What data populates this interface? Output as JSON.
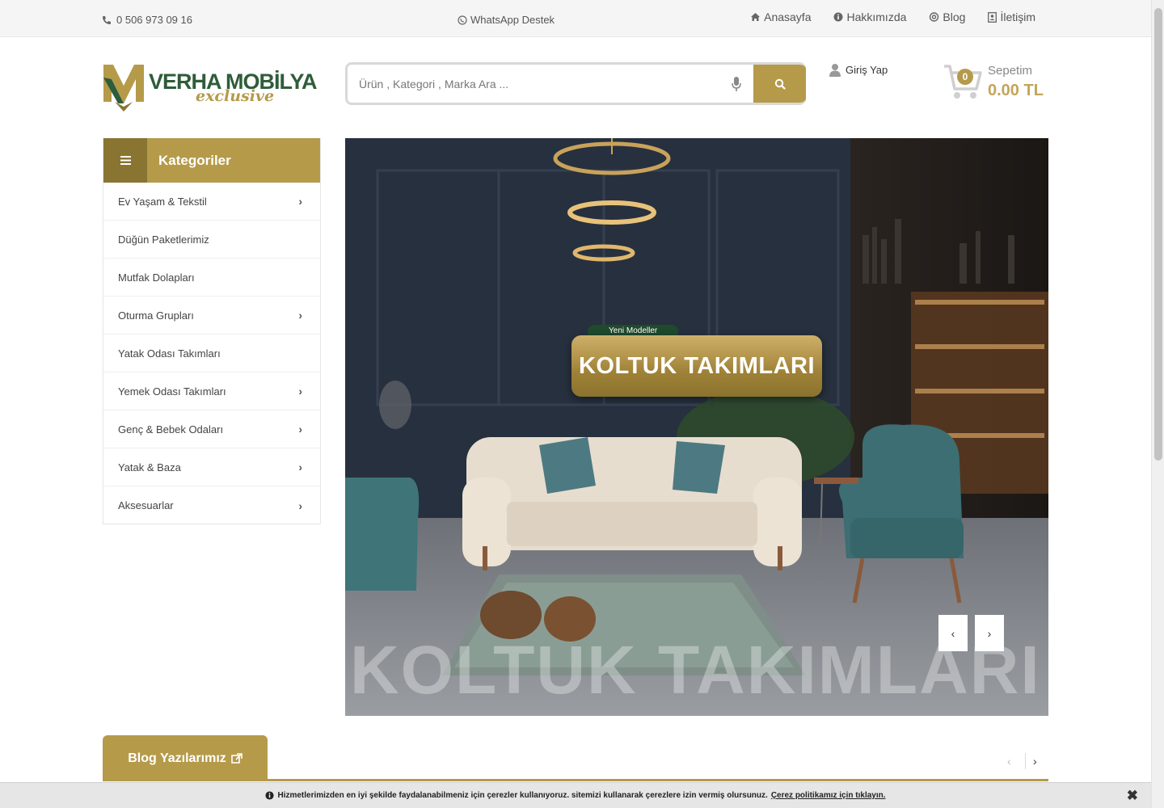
{
  "topbar": {
    "phone": "0 506 973 09 16",
    "whatsapp": "WhatsApp Destek",
    "nav": [
      {
        "label": "Anasayfa",
        "icon": "home-icon"
      },
      {
        "label": "Hakkımızda",
        "icon": "info-icon"
      },
      {
        "label": "Blog",
        "icon": "blog-icon"
      },
      {
        "label": "İletişim",
        "icon": "contact-icon"
      }
    ]
  },
  "header": {
    "logo_brand": "VERHA MOBİLYA",
    "logo_tagline": "exclusive",
    "search_placeholder": "Ürün , Kategori , Marka Ara ...",
    "login_label": "Giriş Yap",
    "cart_label": "Sepetim",
    "cart_count": "0",
    "cart_total": "0.00 TL"
  },
  "categories": {
    "title": "Kategoriler",
    "items": [
      {
        "label": "Ev Yaşam & Tekstil",
        "has_sub": true
      },
      {
        "label": "Düğün Paketlerimiz",
        "has_sub": false
      },
      {
        "label": "Mutfak Dolapları",
        "has_sub": false
      },
      {
        "label": "Oturma Grupları",
        "has_sub": true
      },
      {
        "label": "Yatak Odası Takımları",
        "has_sub": false
      },
      {
        "label": "Yemek Odası Takımları",
        "has_sub": true
      },
      {
        "label": "Genç & Bebek Odaları",
        "has_sub": true
      },
      {
        "label": "Yatak & Baza",
        "has_sub": true
      },
      {
        "label": "Aksesuarlar",
        "has_sub": true
      }
    ]
  },
  "hero": {
    "badge": "Yeni Modeller",
    "title": "KOLTUK TAKIMLARI",
    "ghost_text": "KOLTUK TAKIMLARI",
    "prev": "‹",
    "next": "›"
  },
  "blog": {
    "title": "Blog Yazılarımız",
    "prev": "‹",
    "next": "›"
  },
  "cookie": {
    "text": "Hizmetlerimizden en iyi şekilde faydalanabilmeniz için çerezler kullanıyoruz. sitemizi kullanarak çerezlere izin vermiş olursunuz.",
    "link": "Çerez politikamız için tıklayın.",
    "close": "✖"
  },
  "colors": {
    "accent": "#b59a4a",
    "accent_dark": "#8a7431",
    "logo_green": "#2f5c3a"
  }
}
